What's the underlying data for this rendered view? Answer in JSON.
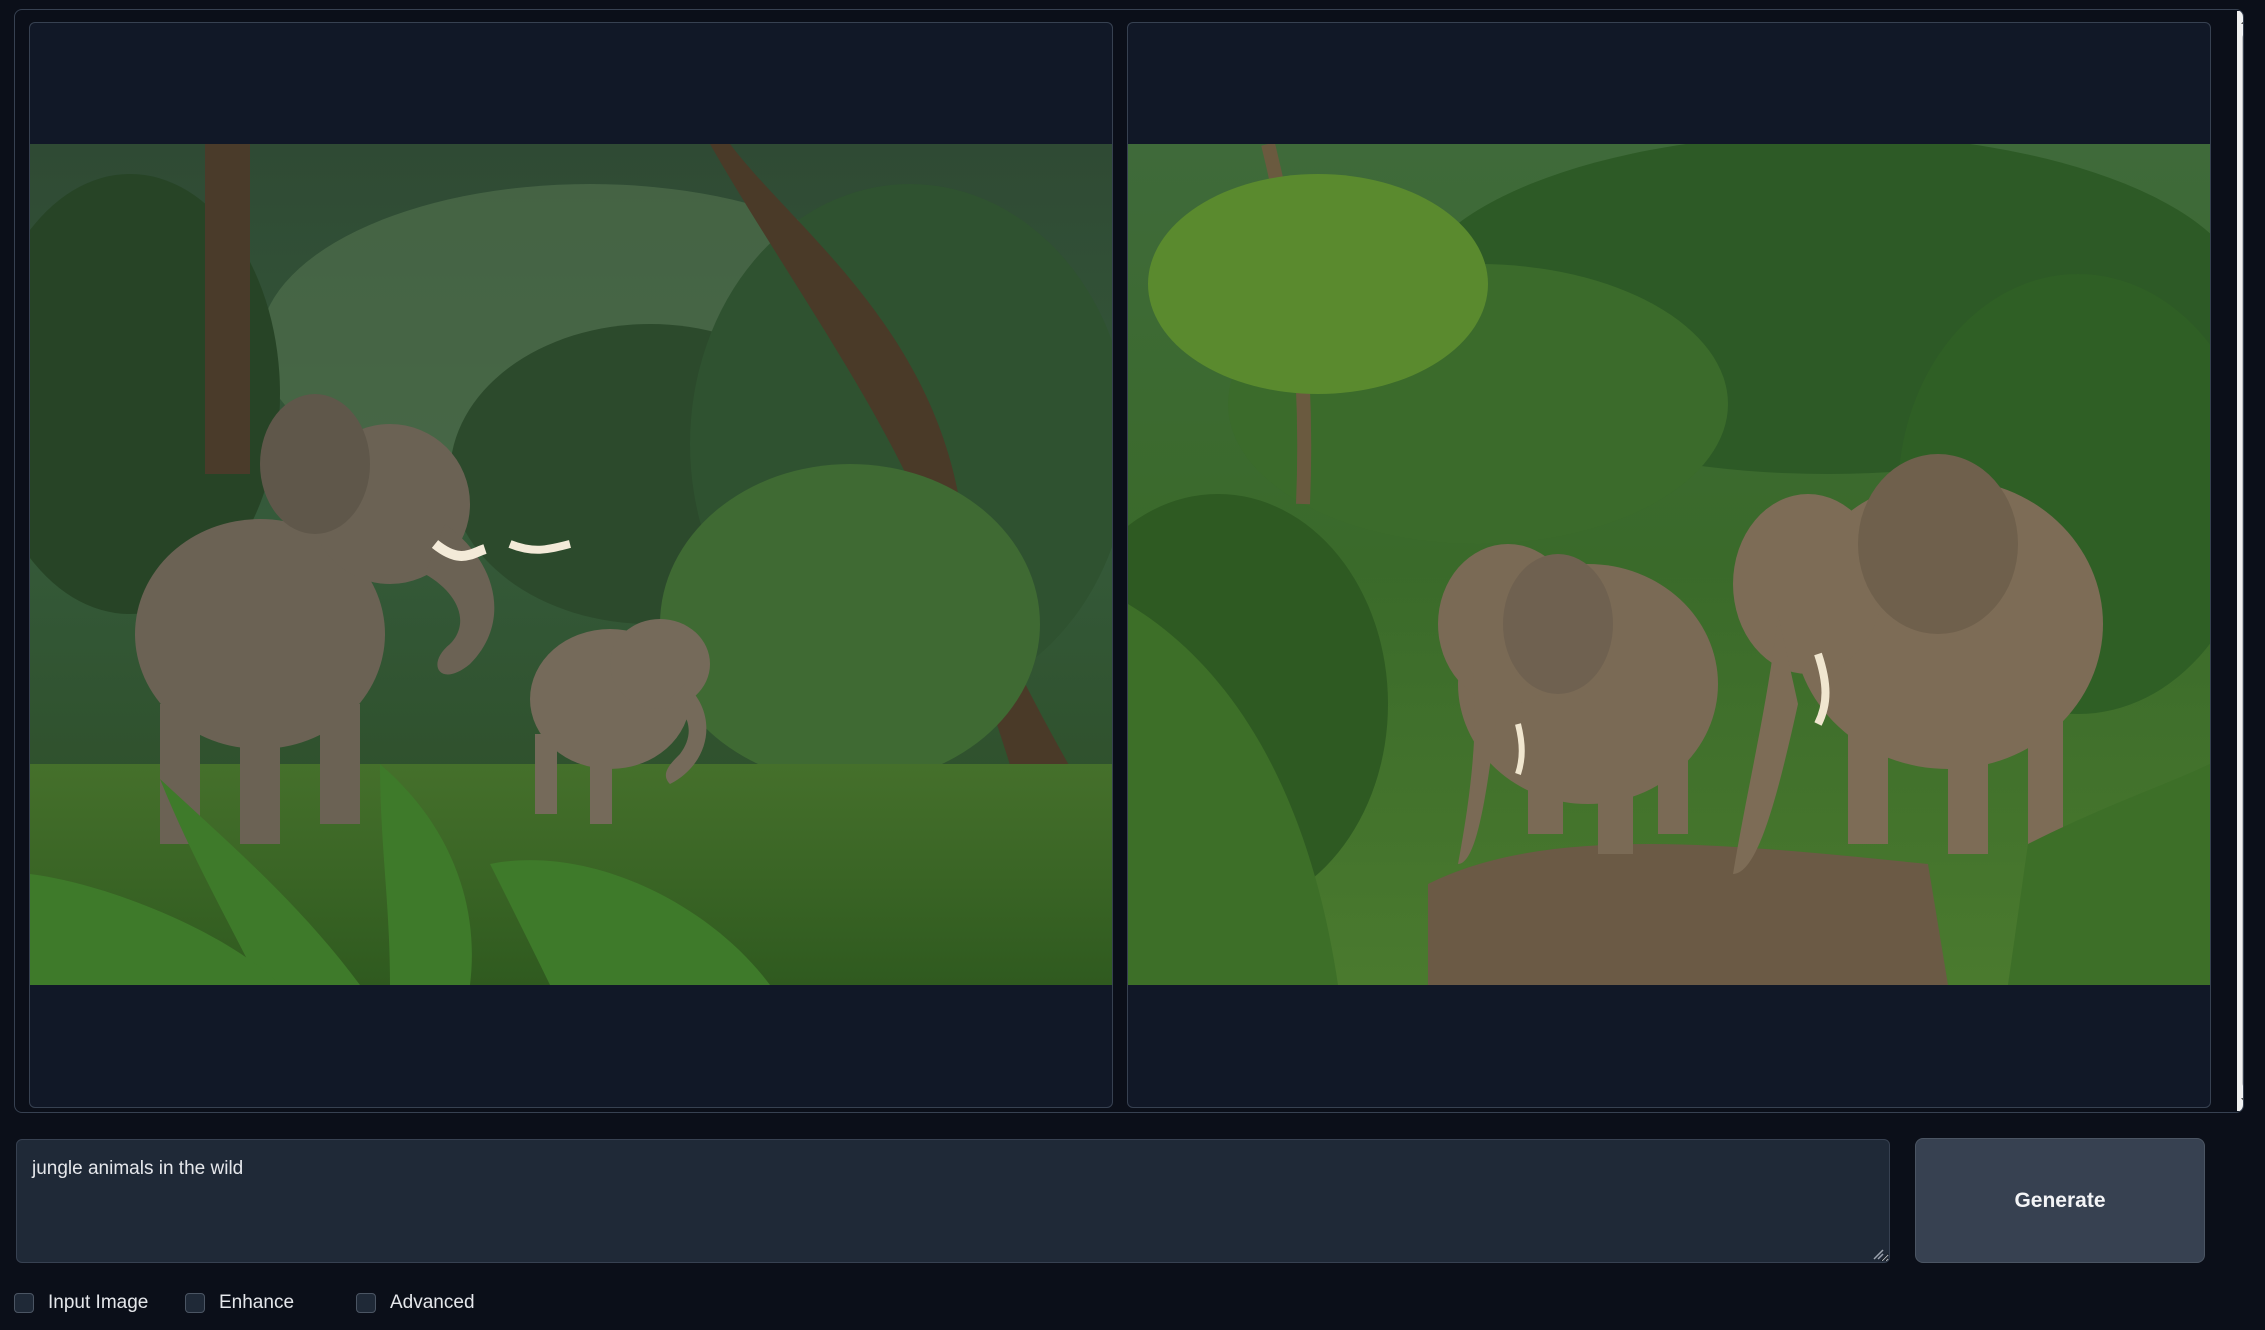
{
  "gallery": {
    "images": [
      {
        "icon": "elephants-in-jungle-image-1"
      },
      {
        "icon": "elephants-in-jungle-image-2"
      }
    ]
  },
  "prompt": {
    "value": "jungle animals in the wild"
  },
  "generate_button": {
    "label": "Generate"
  },
  "options": [
    {
      "label": "Input Image",
      "checked": false
    },
    {
      "label": "Enhance",
      "checked": false
    },
    {
      "label": "Advanced",
      "checked": false
    }
  ],
  "colors": {
    "background": "#0b0f19",
    "panel": "#111827",
    "input": "#1f2937",
    "button": "#374151",
    "text": "#e5e7eb"
  }
}
